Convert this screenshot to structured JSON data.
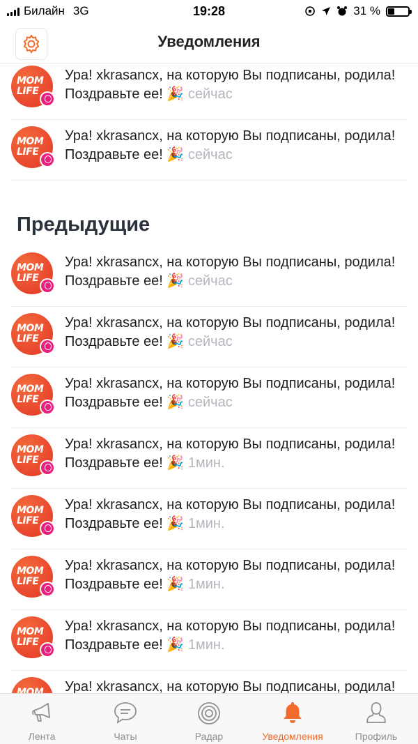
{
  "status_bar": {
    "carrier": "Билайн",
    "network": "3G",
    "time": "19:28",
    "battery": "31 %",
    "battery_level": 0.31
  },
  "header": {
    "title": "Уведомления"
  },
  "notifications_top": [
    {
      "avatar_line1": "MOM",
      "avatar_line2": "LIFE",
      "message": "Ура! xkrasancx, на которую Вы подписаны, родила! Поздравьте ее!",
      "emoji": "🎉",
      "time": "сейчас"
    },
    {
      "avatar_line1": "MOM",
      "avatar_line2": "LIFE",
      "message": "Ура! xkrasancx, на которую Вы подписаны, родила! Поздравьте ее!",
      "emoji": "🎉",
      "time": "сейчас"
    }
  ],
  "section_previous": "Предыдущие",
  "notifications_previous": [
    {
      "avatar_line1": "MOM",
      "avatar_line2": "LIFE",
      "message": "Ура! xkrasancx, на которую Вы подписаны, родила! Поздравьте ее!",
      "emoji": "🎉",
      "time": "сейчас"
    },
    {
      "avatar_line1": "MOM",
      "avatar_line2": "LIFE",
      "message": "Ура! xkrasancx, на которую Вы подписаны, родила! Поздравьте ее!",
      "emoji": "🎉",
      "time": "сейчас"
    },
    {
      "avatar_line1": "MOM",
      "avatar_line2": "LIFE",
      "message": "Ура! xkrasancx, на которую Вы подписаны, родила! Поздравьте ее!",
      "emoji": "🎉",
      "time": "сейчас"
    },
    {
      "avatar_line1": "MOM",
      "avatar_line2": "LIFE",
      "message": "Ура! xkrasancx, на которую Вы подписаны, родила! Поздравьте ее!",
      "emoji": "🎉",
      "time": "1мин."
    },
    {
      "avatar_line1": "MOM",
      "avatar_line2": "LIFE",
      "message": "Ура! xkrasancx, на которую Вы подписаны, родила! Поздравьте ее!",
      "emoji": "🎉",
      "time": "1мин."
    },
    {
      "avatar_line1": "MOM",
      "avatar_line2": "LIFE",
      "message": "Ура! xkrasancx, на которую Вы подписаны, родила! Поздравьте ее!",
      "emoji": "🎉",
      "time": "1мин."
    },
    {
      "avatar_line1": "MOM",
      "avatar_line2": "LIFE",
      "message": "Ура! xkrasancx, на которую Вы подписаны, родила! Поздравьте ее!",
      "emoji": "🎉",
      "time": "1мин."
    },
    {
      "avatar_line1": "MOM",
      "avatar_line2": "LIFE",
      "message": "Ура! xkrasancx, на которую Вы подписаны, родила! Поздравьте ее!",
      "emoji": "🎉",
      "time": ""
    }
  ],
  "tabbar": {
    "items": [
      {
        "label": "Лента",
        "icon": "megaphone-icon",
        "active": false
      },
      {
        "label": "Чаты",
        "icon": "chat-bubble-icon",
        "active": false
      },
      {
        "label": "Радар",
        "icon": "radar-icon",
        "active": false
      },
      {
        "label": "Уведомления",
        "icon": "bell-icon",
        "active": true
      },
      {
        "label": "Профиль",
        "icon": "person-icon",
        "active": false
      }
    ]
  },
  "colors": {
    "accent": "#f26b2a",
    "avatar_bg": "#e8452d",
    "badge": "#ea1f7d",
    "time_text": "#b3b7bd",
    "tab_inactive": "#8e8e93"
  }
}
